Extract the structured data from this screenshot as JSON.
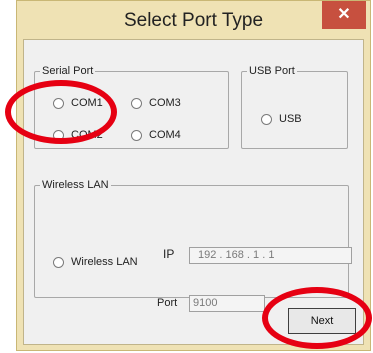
{
  "dialog": {
    "title": "Select Port Type",
    "close_glyph": "✕"
  },
  "serial_port": {
    "legend": "Serial Port",
    "options": [
      {
        "label": "COM1",
        "selected": false
      },
      {
        "label": "COM3",
        "selected": false
      },
      {
        "label": "COM2",
        "selected": false
      },
      {
        "label": "COM4",
        "selected": false
      }
    ]
  },
  "usb_port": {
    "legend": "USB Port",
    "option_label": "USB"
  },
  "wireless_lan": {
    "legend": "Wireless LAN",
    "ip_label": "IP",
    "ip_value": "192 . 168 . 1 . 1",
    "option_label": "Wireless LAN",
    "port_label": "Port",
    "port_value": "9100"
  },
  "actions": {
    "next_label": "Next"
  },
  "annotations": {
    "highlight_color": "#e60012"
  }
}
